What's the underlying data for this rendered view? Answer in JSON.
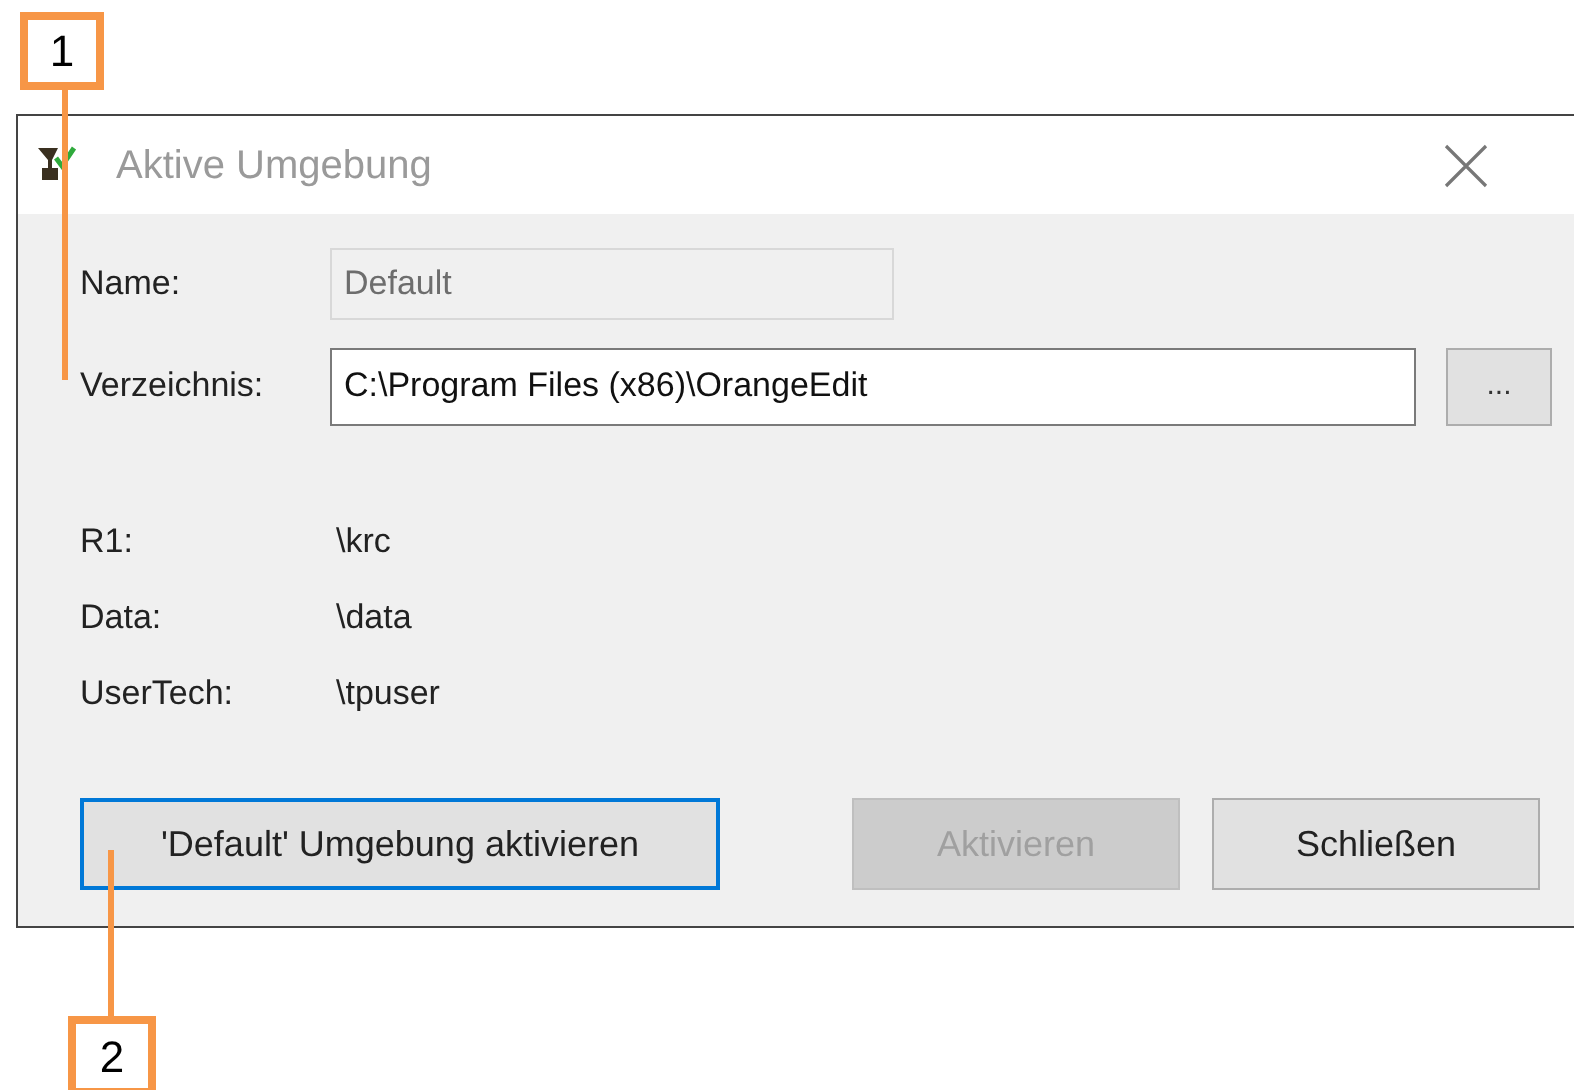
{
  "window": {
    "title": "Aktive Umgebung"
  },
  "fields": [
    {
      "label": "Name:",
      "value": "Default",
      "disabled": true
    },
    {
      "label": "Verzeichnis:",
      "value": "C:\\Program Files (x86)\\OrangeEdit",
      "disabled": false
    }
  ],
  "browse_button": {
    "label": "..."
  },
  "info_rows": [
    {
      "label": "R1:",
      "value": "\\krc"
    },
    {
      "label": "Data:",
      "value": "\\data"
    },
    {
      "label": "UserTech:",
      "value": "\\tpuser"
    }
  ],
  "buttons": [
    {
      "label": "'Default' Umgebung aktivieren",
      "disabled": false,
      "focused": true
    },
    {
      "label": "Aktivieren",
      "disabled": true,
      "focused": false
    },
    {
      "label": "Schließen",
      "disabled": false,
      "focused": false
    }
  ],
  "callouts": [
    {
      "label": "1"
    },
    {
      "label": "2"
    }
  ]
}
